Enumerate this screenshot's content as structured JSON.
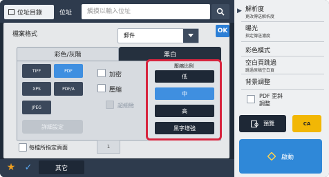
{
  "topbar": {
    "address_book_label": "位址目錄",
    "address_label": "位址",
    "address_placeholder": "觸摸以輸入位址"
  },
  "panel": {
    "ok_label": "OK",
    "file_format_label": "檔案格式",
    "file_format_value": "郵件",
    "tabs": {
      "color_gray": "彩色/灰階",
      "bw": "黑白"
    },
    "format_buttons": [
      {
        "label": "TIFF",
        "selected": false
      },
      {
        "label": "PDF",
        "selected": true
      },
      {
        "label": "XPS",
        "selected": false
      },
      {
        "label": "PDF/A",
        "selected": false
      },
      {
        "label": "JPEG",
        "selected": false
      }
    ],
    "encrypt_label": "加密",
    "compress_label": "壓縮",
    "ultra_fine_label": "超細緻",
    "detail_settings_label": "詳細設定",
    "compression_ratio": {
      "title": "壓縮比例",
      "options": [
        {
          "label": "低",
          "selected": false
        },
        {
          "label": "中",
          "selected": true
        },
        {
          "label": "高",
          "selected": false
        },
        {
          "label": "黑字增強",
          "selected": false
        }
      ]
    },
    "pages_per_file_label": "每檔所指定頁面",
    "pages_per_file_value": "1"
  },
  "bottombar": {
    "other_label": "其它"
  },
  "rightpanel": {
    "items": [
      {
        "title": "解析度",
        "sub": "更改傳送解析度"
      },
      {
        "title": "曝光",
        "sub": "指定傳送濃度"
      },
      {
        "title": "彩色模式",
        "sub": ""
      },
      {
        "title": "空白頁跳過",
        "sub": "跳過原稿空白頁"
      },
      {
        "title": "背景調整",
        "sub": ""
      },
      {
        "title": "PDF 歪斜",
        "sub": "調整"
      }
    ],
    "preview_label": "預覽",
    "ca_label": "CA",
    "start_label": "啟動"
  },
  "colors": {
    "accent_blue": "#3f8fe0",
    "highlight_red": "#d7253f",
    "ca_yellow": "#f2b705",
    "start_blue": "#2f88d8"
  }
}
